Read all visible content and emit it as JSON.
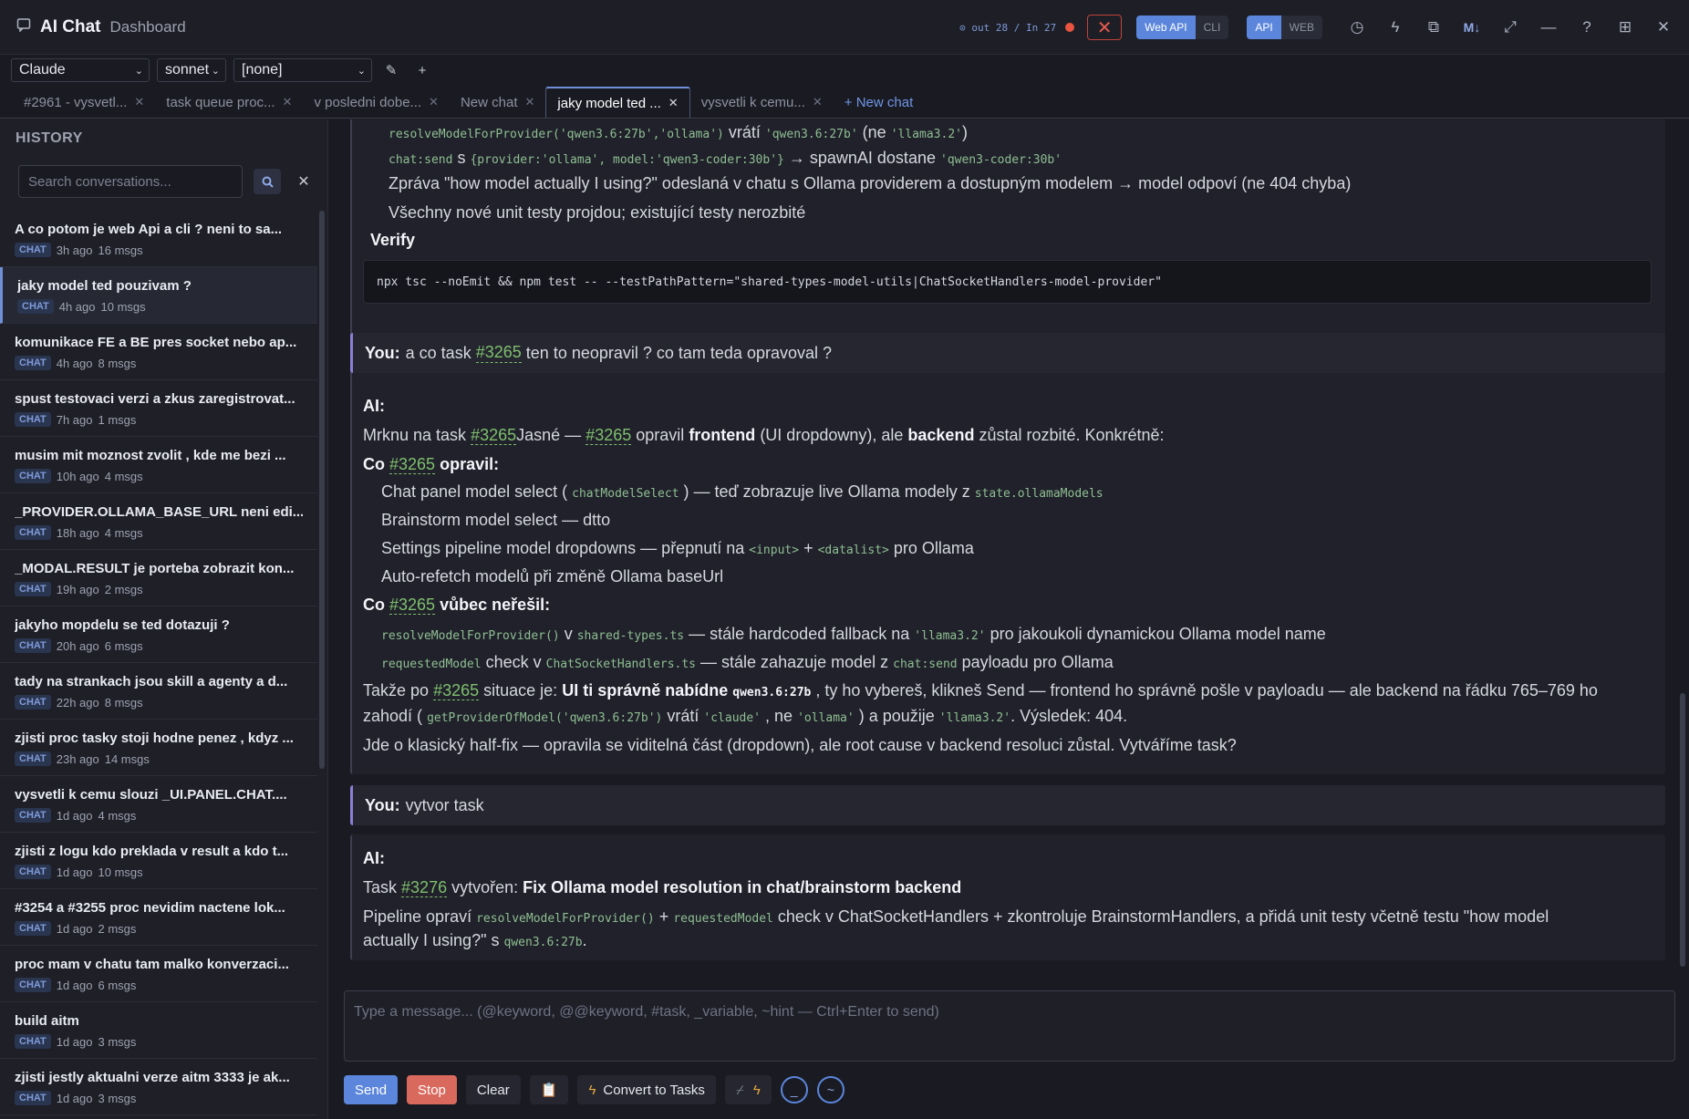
{
  "titlebar": {
    "app_title": "AI Chat",
    "subtitle": "Dashboard",
    "counter": "out 28 / In 27",
    "mode_web_api": "Web API",
    "mode_cli": "CLI",
    "mode_api": "API",
    "mode_web": "WEB",
    "md_label": "M↓"
  },
  "selectors": {
    "provider": "Claude",
    "model": "sonnet",
    "preset": "[none]"
  },
  "tabs": [
    {
      "label": "#2961 - vysvetl..."
    },
    {
      "label": "task queue proc..."
    },
    {
      "label": "v posledni dobe..."
    },
    {
      "label": "New chat"
    },
    {
      "label": "jaky model ted ..."
    },
    {
      "label": "vysvetli k cemu..."
    }
  ],
  "new_tab_label": "+ New chat",
  "history": {
    "title": "HISTORY",
    "search_placeholder": "Search conversations...",
    "items": [
      {
        "title": "A co potom je web Api a cli ? neni to sa...",
        "badge": "CHAT",
        "time": "3h ago",
        "msgs": "16 msgs"
      },
      {
        "title": "jaky model ted pouzivam ?",
        "badge": "CHAT",
        "time": "4h ago",
        "msgs": "10 msgs"
      },
      {
        "title": "komunikace FE a BE pres socket nebo ap...",
        "badge": "CHAT",
        "time": "4h ago",
        "msgs": "8 msgs"
      },
      {
        "title": "spust testovaci verzi a zkus zaregistrovat...",
        "badge": "CHAT",
        "time": "7h ago",
        "msgs": "1 msgs"
      },
      {
        "title": "musim mit moznost zvolit , kde me bezi ...",
        "badge": "CHAT",
        "time": "10h ago",
        "msgs": "4 msgs"
      },
      {
        "title": "_PROVIDER.OLLAMA_BASE_URL neni edi...",
        "badge": "CHAT",
        "time": "18h ago",
        "msgs": "4 msgs"
      },
      {
        "title": "_MODAL.RESULT je porteba zobrazit kon...",
        "badge": "CHAT",
        "time": "19h ago",
        "msgs": "2 msgs"
      },
      {
        "title": "jakyho mopdelu se ted dotazuji ?",
        "badge": "CHAT",
        "time": "20h ago",
        "msgs": "6 msgs"
      },
      {
        "title": "tady na strankach jsou skill a agenty a d...",
        "badge": "CHAT",
        "time": "22h ago",
        "msgs": "8 msgs"
      },
      {
        "title": "zjisti proc tasky stoji hodne penez , kdyz ...",
        "badge": "CHAT",
        "time": "23h ago",
        "msgs": "14 msgs"
      },
      {
        "title": "vysvetli k cemu slouzi _UI.PANEL.CHAT....",
        "badge": "CHAT",
        "time": "1d ago",
        "msgs": "4 msgs"
      },
      {
        "title": "zjisti z logu kdo preklada v result a kdo t...",
        "badge": "CHAT",
        "time": "1d ago",
        "msgs": "10 msgs"
      },
      {
        "title": "#3254 a #3255 proc nevidim nactene lok...",
        "badge": "CHAT",
        "time": "1d ago",
        "msgs": "2 msgs"
      },
      {
        "title": "proc mam v chatu tam malko konverzaci...",
        "badge": "CHAT",
        "time": "1d ago",
        "msgs": "6 msgs"
      },
      {
        "title": "build aitm",
        "badge": "CHAT",
        "time": "1d ago",
        "msgs": "3 msgs"
      },
      {
        "title": "zjisti jestly aktualni verze aitm 3333 je ak...",
        "badge": "CHAT",
        "time": "1d ago",
        "msgs": "3 msgs"
      }
    ]
  },
  "chat": {
    "top": {
      "l0_code1": "resolveModelForProvider('qwen3.6:27b','ollama')",
      "l0_t1": "vrátí",
      "l0_code2": "'qwen3.6:27b'",
      "l0_t2": "(ne",
      "l0_code3": "'llama3.2'",
      "l0_t3": ")",
      "l1_code1": "chat:send",
      "l1_t1": "s",
      "l1_code2": "{provider:'ollama', model:'qwen3-coder:30b'}",
      "l1_t2": "→ spawnAI dostane",
      "l1_code3": "'qwen3-coder:30b'",
      "l2": "Zpráva \"how model actually I using?\" odeslaná v chatu s Ollama providerem a dostupným modelem → model odpoví (ne 404 chyba)",
      "l3": "Všechny nové unit testy projdou; existující testy nerozbité",
      "verify": "Verify",
      "command": "npx tsc --noEmit && npm test -- --testPathPattern=\"shared-types-model-utils|ChatSocketHandlers-model-provider\""
    },
    "you1": {
      "label": "You:",
      "t1": "a co task",
      "task": "#3265",
      "t2": "ten to neopravil ? co tam teda opravoval ?"
    },
    "ai1": {
      "label": "AI:",
      "p1_t1": "Mrknu na task",
      "task": "#3265",
      "p1_t2": "Jasné —",
      "p1_t3": "opravil",
      "p1_b1": "frontend",
      "p1_t4": "(UI dropdowny), ale",
      "p1_b2": "backend",
      "p1_t5": "zůstal rozbité. Konkrétně:",
      "h1_pre": "Co",
      "h1_post": "opravil:",
      "b1_t1": "Chat panel model select (",
      "b1_code1": "chatModelSelect",
      "b1_t2": ") — teď zobrazuje live Ollama modely z",
      "b1_code2": "state.ollamaModels",
      "b2": "Brainstorm model select — dtto",
      "b3_t1": "Settings pipeline model dropdowns — přepnutí na",
      "b3_code1": "<input>",
      "b3_t2": "+",
      "b3_code2": "<datalist>",
      "b3_t3": "pro Ollama",
      "b4": "Auto-refetch modelů při změně Ollama baseUrl",
      "h2_pre": "Co",
      "h2_post": "vůbec neřešil:",
      "c1_code1": "resolveModelForProvider()",
      "c1_t1": "v",
      "c1_code2": "shared-types.ts",
      "c1_t2": "— stále hardcoded fallback na",
      "c1_code3": "'llama3.2'",
      "c1_t3": "pro jakoukoli dynamickou Ollama model name",
      "c2_code1": "requestedModel",
      "c2_t1": "check v",
      "c2_code2": "ChatSocketHandlers.ts",
      "c2_t2": "— stále zahazuje model z",
      "c2_code3": "chat:send",
      "c2_t3": "payloadu pro Ollama",
      "s1_t1": "Takže po",
      "s1_t2": "situace je:",
      "s1_b1": "UI ti správně nabídne",
      "s1_code1": "qwen3.6:27b",
      "s1_t3": ", ty ho vybereš, klikneš Send — frontend ho správně pošle v payloadu — ale backend na řádku 765–769 ho",
      "s2_t1": "zahodí (",
      "s2_code1": "getProviderOfModel('qwen3.6:27b')",
      "s2_t2": "vrátí",
      "s2_code2": "'claude'",
      "s2_t3": ", ne",
      "s2_code3": "'ollama'",
      "s2_t4": ") a použije",
      "s2_code4": "'llama3.2'",
      "s2_t5": ". Výsledek: 404.",
      "s3": "Jde o klasický half-fix — opravila se viditelná část (dropdown), ale root cause v backend resoluci zůstal. Vytváříme task?"
    },
    "you2": {
      "label": "You:",
      "t1": "vytvor task"
    },
    "ai2": {
      "label": "AI:",
      "t1": "Task",
      "task": "#3276",
      "t2": "vytvořen:",
      "title": "Fix Ollama model resolution in chat/brainstorm backend",
      "p_t1": "Pipeline opraví",
      "p_code1": "resolveModelForProvider()",
      "p_t2": "+",
      "p_code2": "requestedModel",
      "p_t3": "check v ChatSocketHandlers + zkontroluje BrainstormHandlers, a přidá unit testy včetně testu \"how model",
      "p2_t1": "actually I using?\" s",
      "p2_code1": "qwen3.6:27b",
      "p2_t2": "."
    }
  },
  "composer": {
    "placeholder": "Type a message... (@keyword, @@keyword, #task, _variable, ~hint — Ctrl+Enter to send)",
    "send": "Send",
    "stop": "Stop",
    "clear": "Clear",
    "convert": "Convert to Tasks"
  }
}
